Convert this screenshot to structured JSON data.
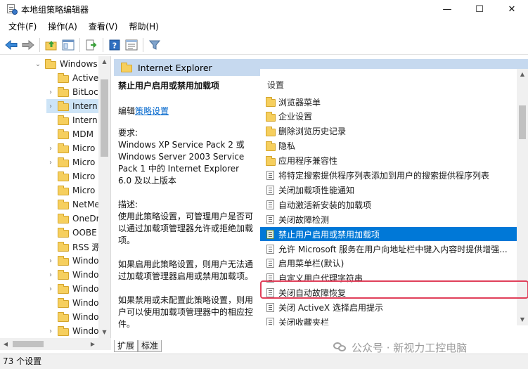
{
  "window": {
    "title": "本地组策略编辑器",
    "minimize": "—",
    "maximize": "☐",
    "close": "✕"
  },
  "menu": [
    "文件(F)",
    "操作(A)",
    "查看(V)",
    "帮助(H)"
  ],
  "toolbar": {
    "icons": [
      "back-icon",
      "forward-icon",
      "up-folder-icon",
      "show-hide-tree-icon",
      "export-list-icon",
      "help-icon",
      "properties-icon",
      "filter-icon"
    ]
  },
  "tree": {
    "items": [
      {
        "label": "Windows",
        "arrow": "⌄",
        "expanded": true
      },
      {
        "label": "Active",
        "arrow": ""
      },
      {
        "label": "BitLoc",
        "arrow": "›"
      },
      {
        "label": "Intern",
        "arrow": "›",
        "selected": true
      },
      {
        "label": "Intern",
        "arrow": ""
      },
      {
        "label": "MDM",
        "arrow": ""
      },
      {
        "label": "Micro",
        "arrow": "›"
      },
      {
        "label": "Micro",
        "arrow": "›"
      },
      {
        "label": "Micro",
        "arrow": ""
      },
      {
        "label": "Micro",
        "arrow": ""
      },
      {
        "label": "NetMe",
        "arrow": ""
      },
      {
        "label": "OneDr",
        "arrow": ""
      },
      {
        "label": "OOBE",
        "arrow": ""
      },
      {
        "label": "RSS 源",
        "arrow": ""
      },
      {
        "label": "Windo",
        "arrow": "›"
      },
      {
        "label": "Windo",
        "arrow": "›"
      },
      {
        "label": "Windo",
        "arrow": "›"
      },
      {
        "label": "Windo",
        "arrow": ""
      },
      {
        "label": "Windo",
        "arrow": ""
      },
      {
        "label": "Windo",
        "arrow": "›"
      }
    ]
  },
  "right": {
    "header_title": "Internet Explorer",
    "description": {
      "heading": "禁止用户启用或禁用加载项",
      "edit_prefix": "编辑",
      "edit_link": "策略设置",
      "requirements": "要求:\nWindows XP Service Pack 2 或 Windows Server 2003 Service Pack 1 中的 Internet Explorer 6.0 及以上版本",
      "desc1": "描述:\n使用此策略设置，可管理用户是否可以通过加载项管理器允许或拒绝加载项。",
      "desc2": "如果启用此策略设置，则用户无法通过加载项管理器启用或禁用加载项。",
      "desc3": "如果禁用或未配置此策略设置，则用户可以使用加载项管理器中的相应控件。"
    },
    "list_header": "设置",
    "items": [
      {
        "type": "folder",
        "label": "浏览器菜单"
      },
      {
        "type": "folder",
        "label": "企业设置"
      },
      {
        "type": "folder",
        "label": "删除浏览历史记录"
      },
      {
        "type": "folder",
        "label": "隐私"
      },
      {
        "type": "folder",
        "label": "应用程序兼容性"
      },
      {
        "type": "setting",
        "label": "将特定搜索提供程序列表添加到用户的搜索提供程序列表"
      },
      {
        "type": "setting",
        "label": "关闭加载项性能通知"
      },
      {
        "type": "setting",
        "label": "自动激活新安装的加载项"
      },
      {
        "type": "setting",
        "label": "关闭故障检测"
      },
      {
        "type": "setting",
        "label": "禁止用户启用或禁用加载项",
        "selected": true
      },
      {
        "type": "setting",
        "label": "允许 Microsoft 服务在用户向地址栏中键入内容时提供增强..."
      },
      {
        "type": "setting",
        "label": "启用菜单栏(默认)"
      },
      {
        "type": "setting",
        "label": "自定义用户代理字符串"
      },
      {
        "type": "setting",
        "label": "关闭自动故障恢复"
      },
      {
        "type": "setting",
        "label": "关闭 ActiveX 选择启用提示"
      },
      {
        "type": "setting",
        "label": "关闭收藏夹栏"
      }
    ]
  },
  "tabs": [
    "扩展",
    "标准"
  ],
  "watermark": "公众号 · 新视力工控电脑",
  "status": "73 个设置"
}
